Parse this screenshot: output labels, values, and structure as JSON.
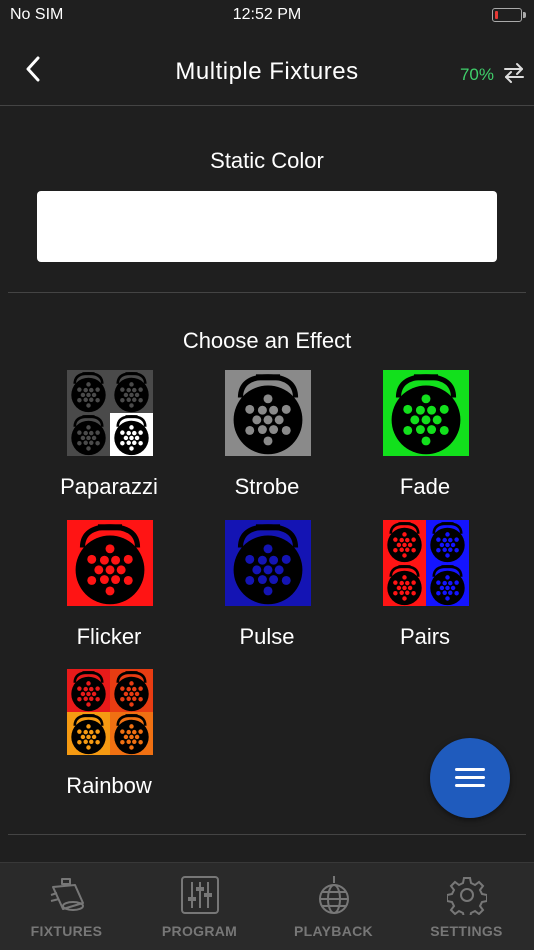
{
  "status_bar": {
    "carrier": "No SIM",
    "time": "12:52 PM",
    "battery_level": 0.12,
    "battery_color": "#e53935"
  },
  "nav": {
    "title": "Multiple Fixtures",
    "percent": "70%",
    "percent_color": "#3fcf6a",
    "back_icon": "chevron-left-icon",
    "sync_icon": "swap-arrows-icon"
  },
  "static_color": {
    "heading": "Static Color",
    "value": "#ffffff"
  },
  "effects": {
    "heading": "Choose an Effect",
    "items": [
      {
        "label": "Paparazzi",
        "tile": [
          "#4a4a4a",
          "#4a4a4a",
          "#4a4a4a",
          "#ffffff"
        ]
      },
      {
        "label": "Strobe",
        "tile": [
          "#8a8a8a"
        ]
      },
      {
        "label": "Fade",
        "tile": [
          "#12e01c"
        ]
      },
      {
        "label": "Flicker",
        "tile": [
          "#ff1414"
        ]
      },
      {
        "label": "Pulse",
        "tile": [
          "#1414b4"
        ]
      },
      {
        "label": "Pairs",
        "tile": [
          "#ff1414",
          "#1414ff",
          "#ff1414",
          "#1414ff"
        ]
      },
      {
        "label": "Rainbow",
        "tile": [
          "#e81a1a",
          "#e83c12",
          "#f59a12",
          "#f07012"
        ]
      }
    ]
  },
  "fab": {
    "icon": "menu-icon",
    "color": "#1f5bbd"
  },
  "tabs": [
    {
      "label": "FIXTURES",
      "icon": "fixture-icon"
    },
    {
      "label": "PROGRAM",
      "icon": "sliders-icon"
    },
    {
      "label": "PLAYBACK",
      "icon": "disco-ball-icon"
    },
    {
      "label": "SETTINGS",
      "icon": "gear-icon"
    }
  ]
}
